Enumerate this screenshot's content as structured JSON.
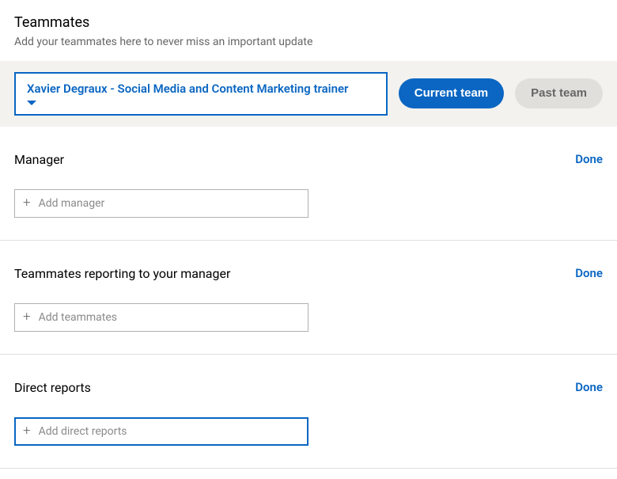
{
  "header": {
    "title": "Teammates",
    "subtitle": "Add your teammates here to never miss an important update"
  },
  "user_selector": {
    "selected": "Xavier Degraux - Social Media and Content Marketing trainer"
  },
  "team_toggle": {
    "current": "Current team",
    "past": "Past team"
  },
  "sections": {
    "manager": {
      "title": "Manager",
      "done": "Done",
      "placeholder": "Add manager"
    },
    "peers": {
      "title": "Teammates reporting to your manager",
      "done": "Done",
      "placeholder": "Add teammates"
    },
    "reports": {
      "title": "Direct reports",
      "done": "Done",
      "placeholder": "Add direct reports"
    }
  }
}
